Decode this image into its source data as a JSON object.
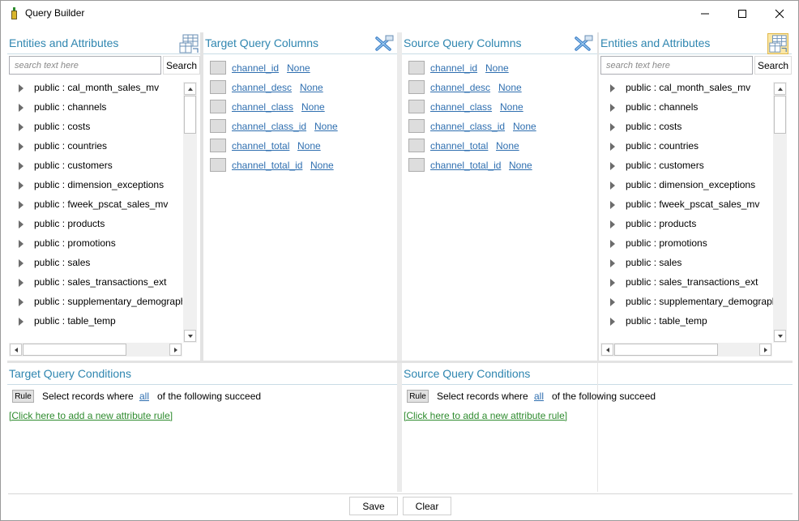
{
  "window": {
    "title": "Query Builder"
  },
  "left_entities": {
    "title": "Entities and Attributes",
    "search_placeholder": "search text here",
    "search_label": "Search",
    "items": [
      "public : cal_month_sales_mv",
      "public : channels",
      "public : costs",
      "public : countries",
      "public : customers",
      "public : dimension_exceptions",
      "public : fweek_pscat_sales_mv",
      "public : products",
      "public : promotions",
      "public : sales",
      "public : sales_transactions_ext",
      "public : supplementary_demographics",
      "public : table_temp"
    ]
  },
  "target_columns": {
    "title": "Target Query Columns",
    "rows": [
      {
        "name": "channel_id",
        "alias": "None"
      },
      {
        "name": "channel_desc",
        "alias": "None"
      },
      {
        "name": "channel_class",
        "alias": "None"
      },
      {
        "name": "channel_class_id",
        "alias": "None"
      },
      {
        "name": "channel_total",
        "alias": "None"
      },
      {
        "name": "channel_total_id",
        "alias": "None"
      }
    ]
  },
  "source_columns": {
    "title": "Source Query Columns",
    "rows": [
      {
        "name": "channel_id",
        "alias": "None"
      },
      {
        "name": "channel_desc",
        "alias": "None"
      },
      {
        "name": "channel_class",
        "alias": "None"
      },
      {
        "name": "channel_class_id",
        "alias": "None"
      },
      {
        "name": "channel_total",
        "alias": "None"
      },
      {
        "name": "channel_total_id",
        "alias": "None"
      }
    ]
  },
  "right_entities": {
    "title": "Entities and Attributes",
    "search_placeholder": "search text here",
    "search_label": "Search",
    "items": [
      "public : cal_month_sales_mv",
      "public : channels",
      "public : costs",
      "public : countries",
      "public : customers",
      "public : dimension_exceptions",
      "public : fweek_pscat_sales_mv",
      "public : products",
      "public : promotions",
      "public : sales",
      "public : sales_transactions_ext",
      "public : supplementary_demographics",
      "public : table_temp"
    ]
  },
  "target_conditions": {
    "title": "Target Query Conditions",
    "rule_label": "Rule",
    "select_text": "Select records where",
    "quantifier": "all",
    "suffix_text": "of the following succeed",
    "add_rule_text": "[Click here to add a new attribute rule]"
  },
  "source_conditions": {
    "title": "Source Query Conditions",
    "rule_label": "Rule",
    "select_text": "Select records where",
    "quantifier": "all",
    "suffix_text": "of the following succeed",
    "add_rule_text": "[Click here to add a new attribute rule]"
  },
  "actions": {
    "save_label": "Save",
    "clear_label": "Clear"
  },
  "colors": {
    "header_text": "#2f86b0",
    "link": "#2f6fb0",
    "add_rule_link": "#2e8b2e"
  }
}
